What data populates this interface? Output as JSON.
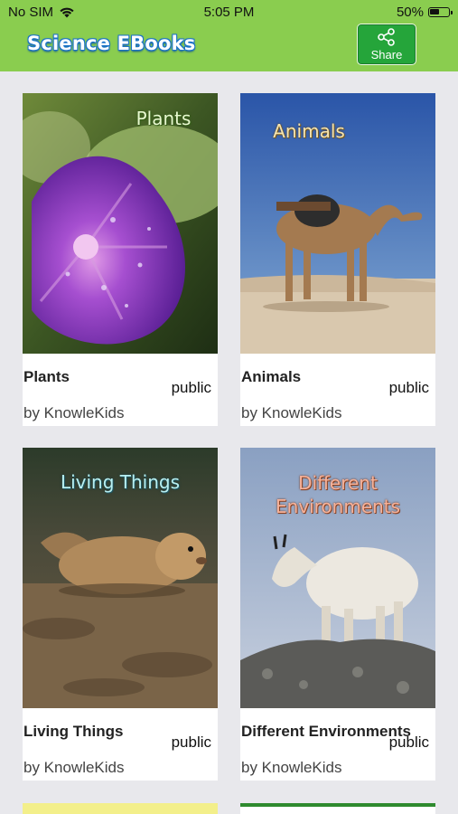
{
  "status_bar": {
    "carrier": "No SIM",
    "time": "5:05 PM",
    "battery_pct": "50%",
    "battery_level": 0.5
  },
  "header": {
    "app_title": "Science EBooks",
    "share_label": "Share",
    "background_color": "#8acd4f"
  },
  "books": [
    {
      "cover_title": "Plants",
      "title": "Plants",
      "visibility": "public",
      "author": "by KnowleKids"
    },
    {
      "cover_title": "Animals",
      "title": "Animals",
      "visibility": "public",
      "author": "by KnowleKids"
    },
    {
      "cover_title": "Living Things",
      "title": "Living Things",
      "visibility": "public",
      "author": "by KnowleKids"
    },
    {
      "cover_title_line1": "Different",
      "cover_title_line2": "Environments",
      "title": "Different Environments",
      "visibility": "public",
      "author": "by KnowleKids"
    }
  ]
}
